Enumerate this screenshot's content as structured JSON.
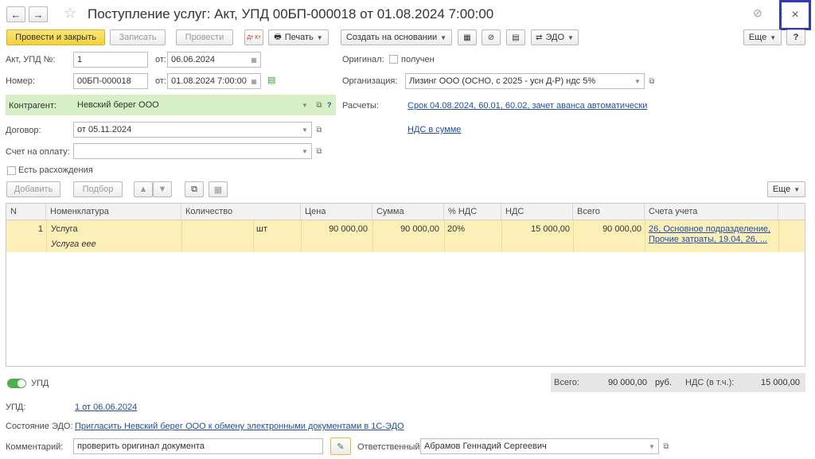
{
  "window": {
    "title": "Поступление услуг: Акт, УПД 00БП-000018 от 01.08.2024 7:00:00",
    "close_symbol": "×",
    "back_symbol": "←",
    "forward_symbol": "→",
    "star_symbol": "☆",
    "link_symbol": "⊘",
    "more_symbol": "⋮"
  },
  "toolbar": {
    "post_close": "Провести и закрыть",
    "save": "Записать",
    "post": "Провести",
    "dtkt": "Дт Кт",
    "print": "Печать",
    "create_based": "Создать на основании",
    "edo": "ЭДО",
    "more": "Еще",
    "help": "?"
  },
  "form": {
    "act_label": "Акт, УПД №:",
    "act_value": "1",
    "act_from_label": "от:",
    "act_date": "06.06.2024",
    "number_label": "Номер:",
    "number_value": "00БП-000018",
    "number_from_label": "от:",
    "number_date": "01.08.2024  7:00:00",
    "original_label": "Оригинал:",
    "original_checkbox_label": "получен",
    "org_label": "Организация:",
    "org_value": "Лизинг ООО (ОСНО, с 2025 - усн Д-Р) ндс 5%",
    "contractor_label": "Контрагент:",
    "contractor_value": "Невский берег ООО",
    "contractor_help": "?",
    "settlements_label": "Расчеты:",
    "settlements_link": "Срок 04.08.2024, 60.01, 60.02, зачет аванса автоматически",
    "vat_link": "НДС в сумме",
    "contract_label": "Договор:",
    "contract_value": "от 05.11.2024",
    "invoice_label": "Счет на оплату:",
    "invoice_value": "",
    "discrepancy_label": "Есть расхождения"
  },
  "table_toolbar": {
    "add": "Добавить",
    "pick": "Подбор",
    "more": "Еще"
  },
  "table": {
    "columns": [
      "N",
      "Номенклатура",
      "Количество",
      "Цена",
      "Сумма",
      "% НДС",
      "НДС",
      "Всего",
      "Счета учета"
    ],
    "rows": [
      {
        "n": "1",
        "item": "Услуга",
        "item_desc": "Услуга еее",
        "unit": "шт",
        "price": "90 000,00",
        "sum": "90 000,00",
        "vat_rate": "20%",
        "vat": "15 000,00",
        "total": "90 000,00",
        "accounts_line1": "26, Основное подразделение,",
        "accounts_line2": "Прочие затраты, 19.04, 26, ..."
      }
    ]
  },
  "footer": {
    "upd_toggle_label": "УПД",
    "totals_label": "Всего:",
    "totals_value": "90 000,00",
    "currency": "руб.",
    "vat_label": "НДС (в т.ч.):",
    "vat_value": "15 000,00",
    "upd_label": "УПД:",
    "upd_link": "1 от 06.06.2024",
    "edo_state_label": "Состояние ЭДО:",
    "edo_state_link": "Пригласить Невский берег ООО к обмену электронными документами в 1С-ЭДО",
    "comment_label": "Комментарий:",
    "comment_value": "проверить оригинал документа",
    "responsible_label": "Ответственный:",
    "responsible_value": "Абрамов Геннадий Сергеевич"
  }
}
